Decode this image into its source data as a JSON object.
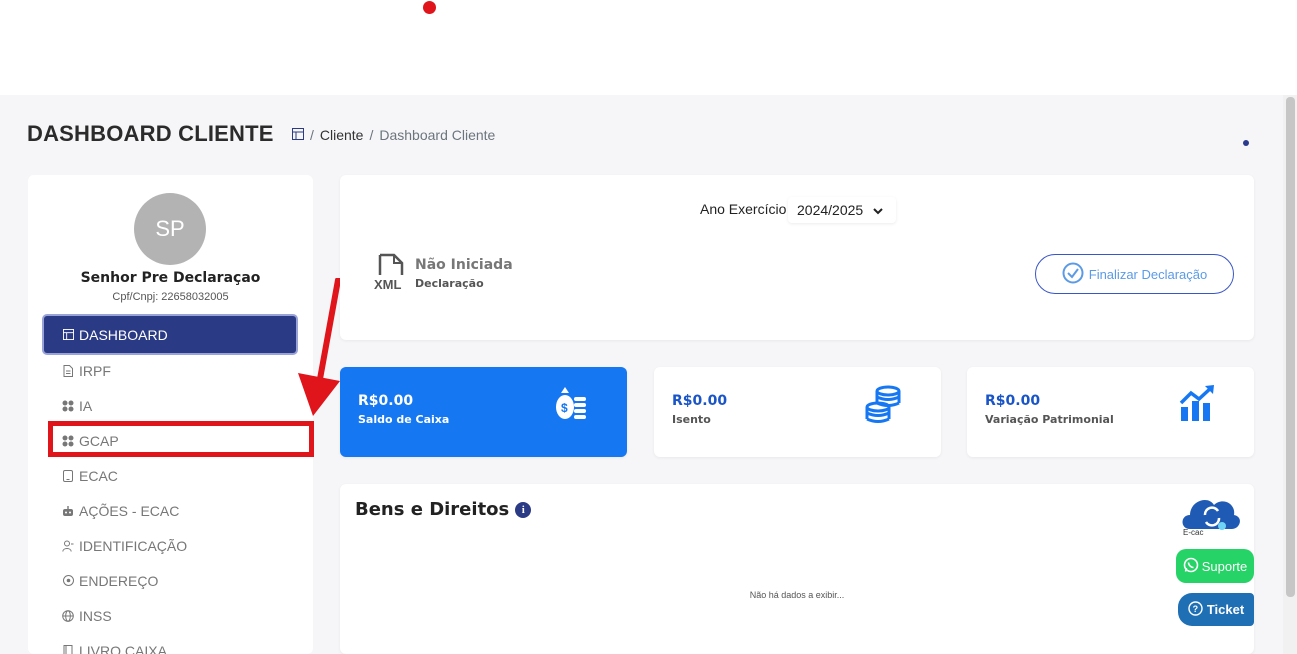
{
  "page": {
    "title": "DASHBOARD CLIENTE",
    "breadcrumb": [
      "Cliente",
      "Dashboard Cliente"
    ]
  },
  "user": {
    "initials": "SP",
    "name": "Senhor Pre Declaraçao",
    "doc": "Cpf/Cnpj: 22658032005"
  },
  "menu": [
    {
      "label": "DASHBOARD",
      "icon": "dashboard-icon",
      "active": true
    },
    {
      "label": "IRPF",
      "icon": "document-icon"
    },
    {
      "label": "IA",
      "icon": "grid-icon"
    },
    {
      "label": "GCAP",
      "icon": "grid-icon"
    },
    {
      "label": "ECAC",
      "icon": "tablet-icon"
    },
    {
      "label": "AÇÕES - ECAC",
      "icon": "robot-icon"
    },
    {
      "label": "IDENTIFICAÇÃO",
      "icon": "person-icon"
    },
    {
      "label": "ENDEREÇO",
      "icon": "location-icon"
    },
    {
      "label": "INSS",
      "icon": "globe-icon"
    },
    {
      "label": "LIVRO CAIXA",
      "icon": "book-icon"
    }
  ],
  "declaration": {
    "ano_label": "Ano Exercício",
    "ano_value": "2024/2025",
    "icon_text": "XML",
    "status": "Não Iniciada",
    "status_sub": "Declaração",
    "finalize_label": "Finalizar Declaração"
  },
  "stats": [
    {
      "value": "R$0.00",
      "label": "Saldo de Caixa",
      "icon": "money-bag-icon"
    },
    {
      "value": "R$0.00",
      "label": "Isento",
      "icon": "coins-icon"
    },
    {
      "value": "R$0.00",
      "label": "Variação Patrimonial",
      "icon": "chart-up-icon"
    }
  ],
  "bens": {
    "title": "Bens e Direitos",
    "empty": "Não há dados a exibir..."
  },
  "floating": {
    "ecac": "E-cac",
    "suporte": "Suporte",
    "ticket": "Ticket"
  },
  "colors": {
    "primary": "#2b3a84",
    "accent_blue": "#1677f2",
    "highlight_red": "#e0151b",
    "whatsapp": "#25d366"
  }
}
